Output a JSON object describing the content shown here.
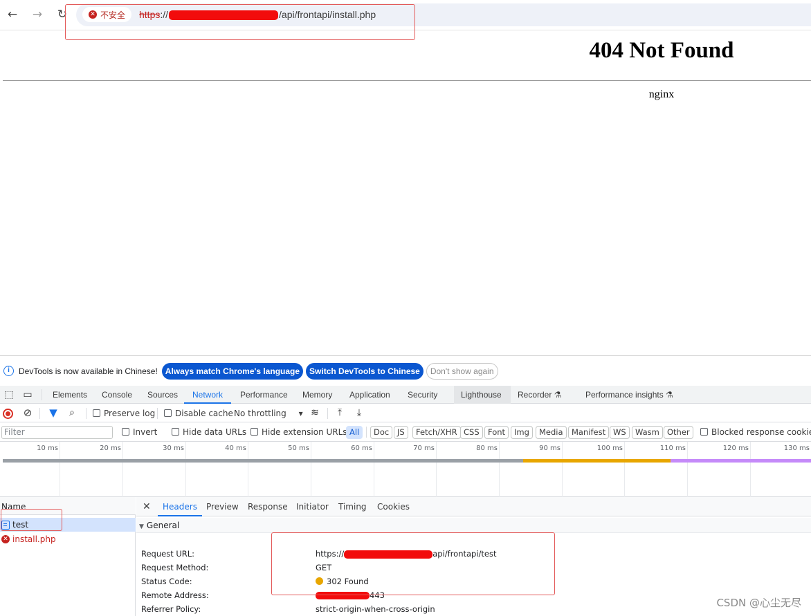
{
  "browser": {
    "back_icon": "←",
    "forward_icon": "→",
    "reload_icon": "↻",
    "security_label": "不安全",
    "url_scheme": "https",
    "url_sep": "://",
    "url_path": "/api/frontapi/install.php"
  },
  "page": {
    "title": "404 Not Found",
    "server": "nginx"
  },
  "devtools": {
    "infobar": {
      "text": "DevTools is now available in Chinese!",
      "btn_match": "Always match Chrome's language",
      "btn_switch": "Switch DevTools to Chinese",
      "btn_dismiss": "Don't show again"
    },
    "tabs": {
      "elements": "Elements",
      "console": "Console",
      "sources": "Sources",
      "network": "Network",
      "performance": "Performance",
      "memory": "Memory",
      "application": "Application",
      "security": "Security",
      "lighthouse": "Lighthouse",
      "recorder": "Recorder",
      "perf_insights": "Performance insights"
    },
    "toolbar": {
      "preserve_log": "Preserve log",
      "disable_cache": "Disable cache",
      "throttling": "No throttling"
    },
    "filters": {
      "placeholder": "Filter",
      "invert": "Invert",
      "hide_data_urls": "Hide data URLs",
      "hide_extension_urls": "Hide extension URLs",
      "types": [
        "All",
        "Doc",
        "JS",
        "Fetch/XHR",
        "CSS",
        "Font",
        "Img",
        "Media",
        "Manifest",
        "WS",
        "Wasm",
        "Other"
      ],
      "blocked_cookies": "Blocked response cookies"
    },
    "timeline": {
      "ticks": [
        "10 ms",
        "20 ms",
        "30 ms",
        "40 ms",
        "50 ms",
        "60 ms",
        "70 ms",
        "80 ms",
        "90 ms",
        "100 ms",
        "110 ms",
        "120 ms",
        "130 ms"
      ]
    },
    "requests": {
      "column": "Name",
      "rows": [
        {
          "name": "test",
          "selected": true,
          "error": false
        },
        {
          "name": "install.php",
          "selected": false,
          "error": true
        }
      ]
    },
    "detail": {
      "close_icon": "✕",
      "tabs": [
        "Headers",
        "Preview",
        "Response",
        "Initiator",
        "Timing",
        "Cookies"
      ],
      "section": "General",
      "rows": {
        "request_url_key": "Request URL:",
        "request_url_prefix": "https://",
        "request_url_path": "api/frontapi/test",
        "method_key": "Request Method:",
        "method_val": "GET",
        "status_key": "Status Code:",
        "status_val": "302 Found",
        "remote_key": "Remote Address:",
        "remote_val": "443",
        "referrer_key": "Referrer Policy:",
        "referrer_val": "strict-origin-when-cross-origin"
      }
    }
  },
  "watermark": "CSDN @心尘无尽",
  "colors": {
    "accent": "#1a73e8",
    "error": "#c5221f",
    "annotation": "#e35a5a",
    "redaction": "#f20c0c",
    "status_302": "#e8a600"
  }
}
